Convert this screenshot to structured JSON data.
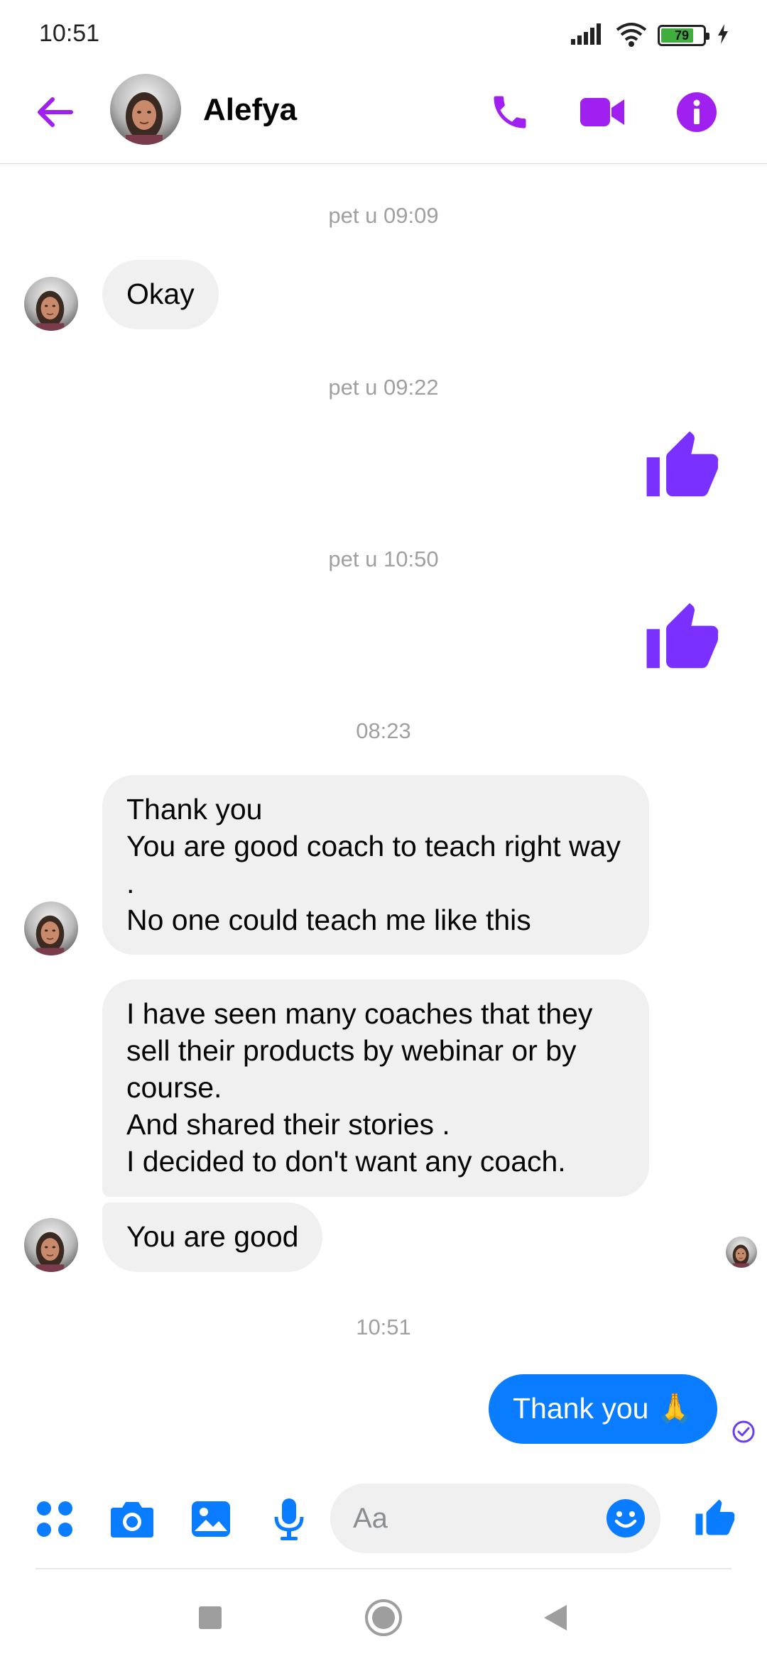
{
  "status_bar": {
    "time": "10:51",
    "battery_level": "79",
    "battery_fraction": 0.79
  },
  "header": {
    "contact_name": "Alefya"
  },
  "colors": {
    "accent": "#a020f0",
    "like": "#7a30ff",
    "messenger_blue": "#0a7cff",
    "bubble_in": "#f0f0f0"
  },
  "icons": {
    "back": "arrow-left-icon",
    "call": "phone-icon",
    "video": "video-camera-icon",
    "info": "info-icon",
    "apps": "four-dots-icon",
    "camera": "camera-icon",
    "gallery": "image-icon",
    "mic": "microphone-icon",
    "emoji": "smiley-icon",
    "like": "thumbs-up-icon",
    "seen": "check-circle-icon"
  },
  "conversation": {
    "ts1": "pet u 09:09",
    "msg_okay": "Okay",
    "ts2": "pet u 09:22",
    "ts3": "pet u 10:50",
    "ts4": "08:23",
    "msg_thank_coach": "Thank you\nYou are good coach  to teach right way .\nNo one could  teach me like this",
    "msg_coaches": "I have seen many coaches that they sell their products  by webinar  or by course.\nAnd shared  their stories .\nI decided to don't want any coach.",
    "msg_you_good": "You are good",
    "ts5": "10:51",
    "msg_outgoing": "Thank you 🙏"
  },
  "composer": {
    "placeholder": "Aa"
  }
}
